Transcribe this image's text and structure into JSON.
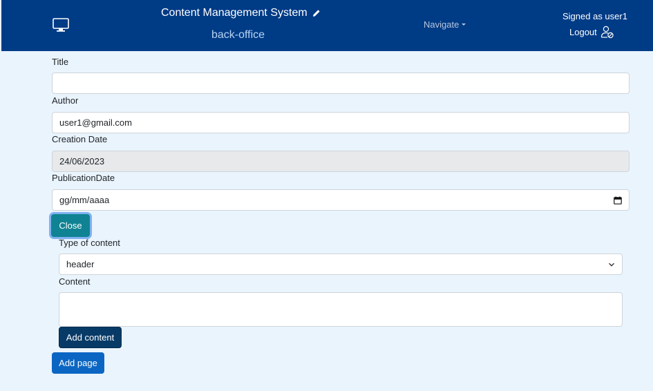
{
  "header": {
    "title": "Content Management System",
    "subtitle": "back-office",
    "navigate_label": "Navigate",
    "signed_as": "Signed as user1",
    "logout_label": "Logout"
  },
  "form": {
    "title_label": "Title",
    "title_value": "",
    "author_label": "Author",
    "author_value": "user1@gmail.com",
    "creation_date_label": "Creation Date",
    "creation_date_value": "24/06/2023",
    "publication_date_label": "PublicationDate",
    "publication_date_value": "gg/mm/aaaa",
    "close_button": "Close",
    "type_label": "Type of content",
    "type_selected": "header",
    "content_label": "Content",
    "content_value": "",
    "add_content_button": "Add content",
    "add_page_button": "Add page"
  },
  "colors": {
    "navbar": "#003b86",
    "page_background": "#eaf4fd",
    "close_button": "#0f8393",
    "add_content_button": "#073a67",
    "add_page_button": "#0b66c3"
  },
  "icons": [
    "monitor-icon",
    "pencil-icon",
    "user-slash-icon",
    "calendar-icon",
    "chevron-down-icon"
  ]
}
